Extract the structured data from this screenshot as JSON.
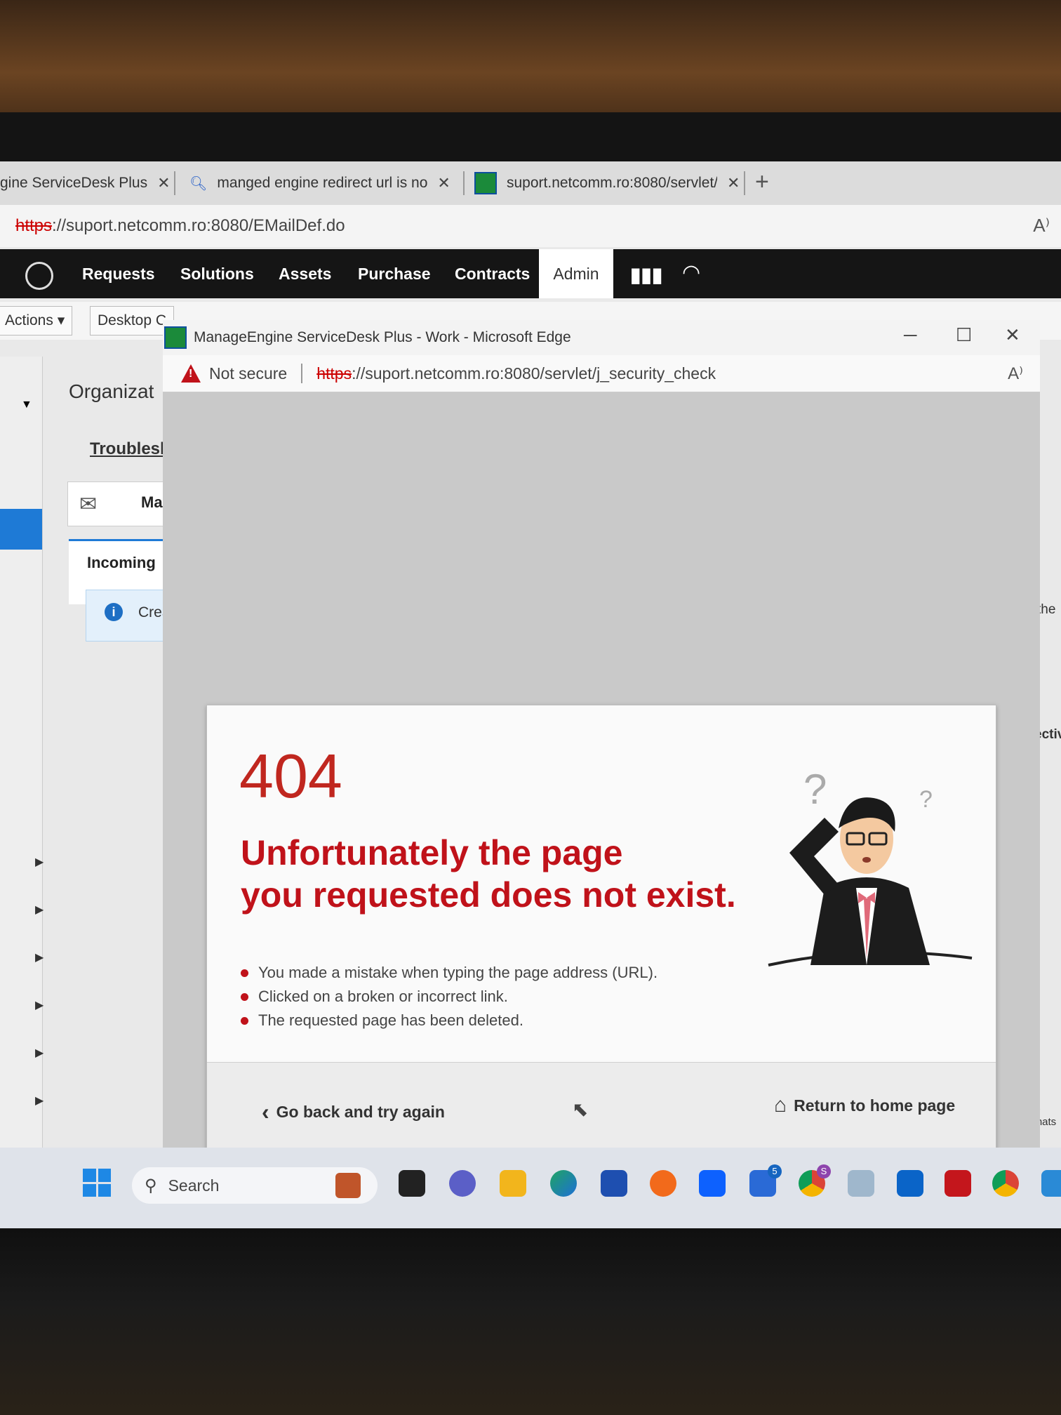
{
  "back_browser": {
    "tabs": [
      {
        "label": "gine ServiceDesk Plus"
      },
      {
        "label": "manged engine redirect url is no"
      },
      {
        "label": "suport.netcomm.ro:8080/servlet/"
      }
    ],
    "address": {
      "scheme": "https",
      "rest": "://suport.netcomm.ro:8080/EMailDef.do"
    },
    "nav": [
      "Requests",
      "Solutions",
      "Assets",
      "Purchase",
      "Contracts",
      "Admin"
    ],
    "toolbar": {
      "actions_label": "Actions",
      "desktop_label": "Desktop C"
    },
    "background_text": {
      "organization": "Organizat",
      "troubleshoot": "Troublesh",
      "mail": "Ma",
      "incoming": "Incoming",
      "create": "Crea",
      "the": "the",
      "ective": "ectiv"
    },
    "chats_label": "Chats"
  },
  "popup": {
    "window_title": "ManageEngine ServiceDesk Plus - Work - Microsoft Edge",
    "security_label": "Not secure",
    "address": {
      "scheme": "https",
      "rest": "://suport.netcomm.ro:8080/servlet/j_security_check"
    },
    "error": {
      "code": "404",
      "headline_line1": "Unfortunately the page",
      "headline_line2": "you requested does not exist.",
      "reasons": [
        "You made a mistake when typing the page address (URL).",
        "Clicked on a broken or incorrect link.",
        "The requested page has been deleted."
      ],
      "back_label": "Go back and try again",
      "home_label": "Return to home page"
    }
  },
  "taskbar": {
    "search_label": "Search",
    "todo_badge": "5",
    "chrome_badge": "S"
  },
  "colors": {
    "accent_red": "#c0121a",
    "nav_bg": "#151515",
    "windows_blue": "#1e7ad6"
  }
}
